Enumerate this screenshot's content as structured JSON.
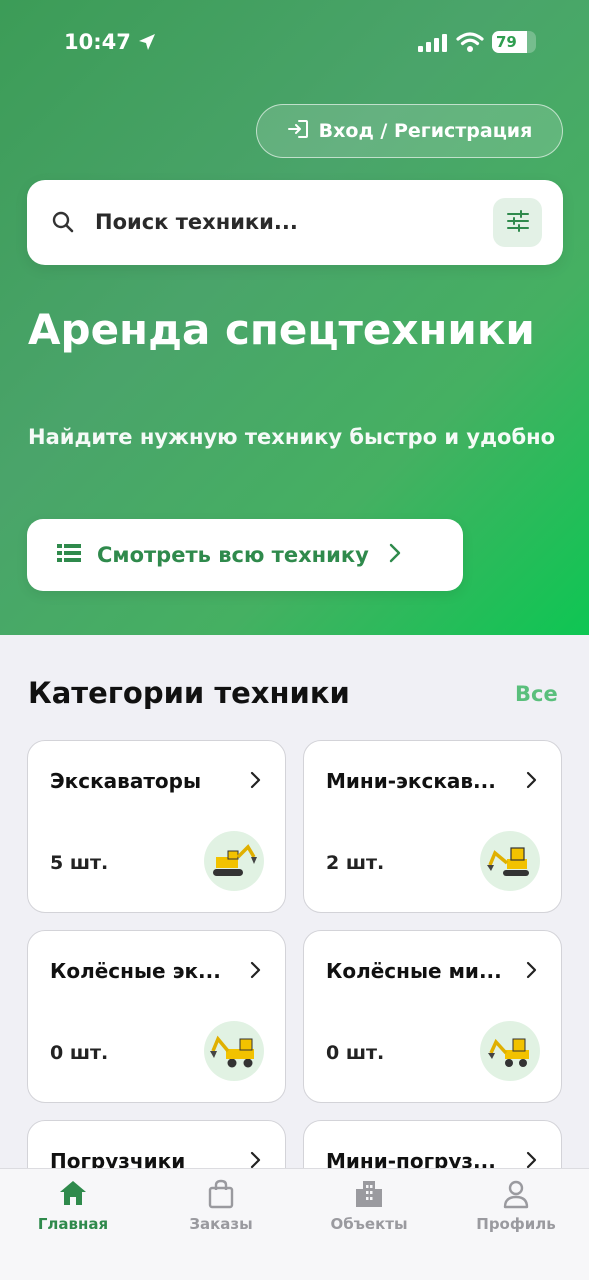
{
  "status_bar": {
    "time": "10:47",
    "battery": "79"
  },
  "header": {
    "login_label": "Вход / Регистрация"
  },
  "search": {
    "placeholder": "Поиск техники..."
  },
  "hero": {
    "title": "Аренда спецтехники",
    "subtitle": "Найдите нужную технику быстро и удобно",
    "view_all_label": "Смотреть всю технику"
  },
  "categories": {
    "title": "Категории техники",
    "all_label": "Все",
    "items": [
      {
        "name": "Экскаваторы",
        "count": "5 шт.",
        "icon": "excavator-icon"
      },
      {
        "name": "Мини-экскав...",
        "count": "2 шт.",
        "icon": "mini-excavator-icon"
      },
      {
        "name": "Колёсные эк...",
        "count": "0 шт.",
        "icon": "wheeled-excavator-icon"
      },
      {
        "name": "Колёсные ми...",
        "count": "0 шт.",
        "icon": "wheeled-mini-excavator-icon"
      },
      {
        "name": "Погрузчики",
        "count": "",
        "icon": "loader-icon"
      },
      {
        "name": "Мини-погруз...",
        "count": "",
        "icon": "mini-loader-icon"
      }
    ]
  },
  "tabbar": {
    "items": [
      {
        "label": "Главная",
        "icon": "home-icon",
        "active": true
      },
      {
        "label": "Заказы",
        "icon": "bag-icon",
        "active": false
      },
      {
        "label": "Объекты",
        "icon": "buildings-icon",
        "active": false
      },
      {
        "label": "Профиль",
        "icon": "user-icon",
        "active": false
      }
    ]
  },
  "colors": {
    "accent": "#2f8a4c",
    "hero_start": "#3c9c57",
    "hero_end": "#0ec653",
    "card_icon_bg": "#e1f2e3"
  }
}
